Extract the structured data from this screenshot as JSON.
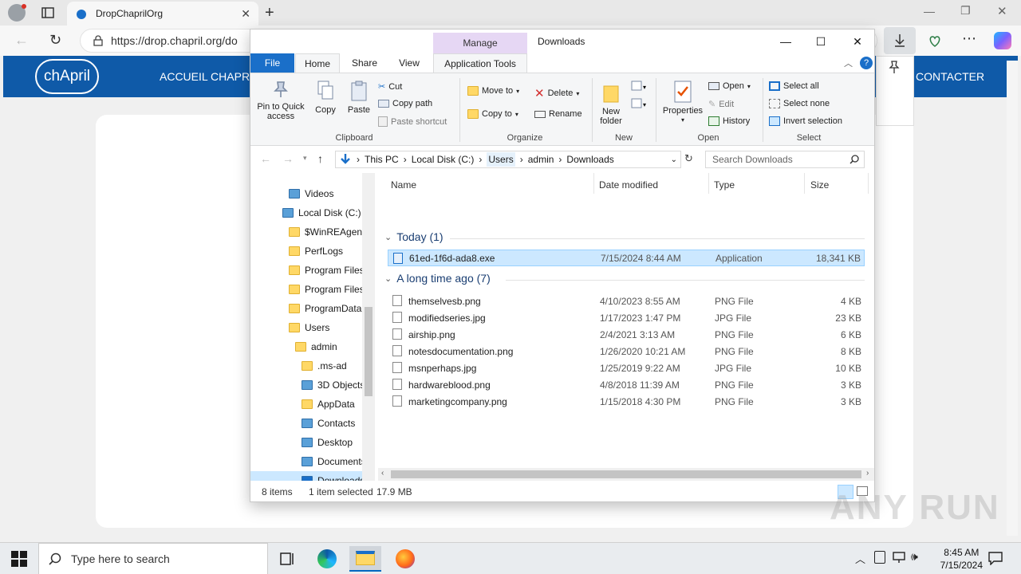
{
  "browser": {
    "tab_title": "DropChaprilOrg",
    "url": "https://drop.chapril.org/do"
  },
  "site": {
    "logo": "chApril",
    "nav": [
      "ACCUEIL CHAPRIL",
      "CONTACTER"
    ]
  },
  "explorer": {
    "contextual_tab": "Manage",
    "window_title": "Downloads",
    "ribbon_tabs": [
      "File",
      "Home",
      "Share",
      "View",
      "Application Tools"
    ],
    "clipboard": {
      "pin": "Pin to Quick access",
      "copy": "Copy",
      "paste": "Paste",
      "cut": "Cut",
      "copy_path": "Copy path",
      "paste_shortcut": "Paste shortcut",
      "label": "Clipboard"
    },
    "organize": {
      "move_to": "Move to",
      "copy_to": "Copy to",
      "delete": "Delete",
      "rename": "Rename",
      "label": "Organize"
    },
    "new": {
      "new_folder": "New folder",
      "label": "New"
    },
    "open": {
      "properties": "Properties",
      "open": "Open",
      "edit": "Edit",
      "history": "History",
      "label": "Open"
    },
    "select": {
      "select_all": "Select all",
      "select_none": "Select none",
      "invert": "Invert selection",
      "label": "Select"
    },
    "breadcrumb": [
      "This PC",
      "Local Disk (C:)",
      "Users",
      "admin",
      "Downloads"
    ],
    "search_placeholder": "Search Downloads",
    "tree": [
      {
        "label": "Videos",
        "indent": 1
      },
      {
        "label": "Local Disk (C:)",
        "indent": 0
      },
      {
        "label": "$WinREAgent",
        "indent": 1
      },
      {
        "label": "PerfLogs",
        "indent": 1
      },
      {
        "label": "Program Files",
        "indent": 1
      },
      {
        "label": "Program Files",
        "indent": 1
      },
      {
        "label": "ProgramData",
        "indent": 1
      },
      {
        "label": "Users",
        "indent": 1
      },
      {
        "label": "admin",
        "indent": 2
      },
      {
        "label": ".ms-ad",
        "indent": 3
      },
      {
        "label": "3D Objects",
        "indent": 3
      },
      {
        "label": "AppData",
        "indent": 3
      },
      {
        "label": "Contacts",
        "indent": 3
      },
      {
        "label": "Desktop",
        "indent": 3
      },
      {
        "label": "Documents",
        "indent": 3
      },
      {
        "label": "Downloads",
        "indent": 3
      }
    ],
    "columns": [
      "Name",
      "Date modified",
      "Type",
      "Size"
    ],
    "groups": [
      {
        "title": "Today (1)",
        "files": [
          {
            "name": "61ed-1f6d-ada8.exe",
            "date": "7/15/2024 8:44 AM",
            "type": "Application",
            "size": "18,341 KB",
            "selected": true
          }
        ]
      },
      {
        "title": "A long time ago (7)",
        "files": [
          {
            "name": "themselvesb.png",
            "date": "4/10/2023 8:55 AM",
            "type": "PNG File",
            "size": "4 KB"
          },
          {
            "name": "modifiedseries.jpg",
            "date": "1/17/2023 1:47 PM",
            "type": "JPG File",
            "size": "23 KB"
          },
          {
            "name": "airship.png",
            "date": "2/4/2021 3:13 AM",
            "type": "PNG File",
            "size": "6 KB"
          },
          {
            "name": "notesdocumentation.png",
            "date": "1/26/2020 10:21 AM",
            "type": "PNG File",
            "size": "8 KB"
          },
          {
            "name": "msnperhaps.jpg",
            "date": "1/25/2019 9:22 AM",
            "type": "JPG File",
            "size": "10 KB"
          },
          {
            "name": "hardwareblood.png",
            "date": "4/8/2018 11:39 AM",
            "type": "PNG File",
            "size": "3 KB"
          },
          {
            "name": "marketingcompany.png",
            "date": "1/15/2018 4:30 PM",
            "type": "PNG File",
            "size": "3 KB"
          }
        ]
      }
    ],
    "status": {
      "items": "8 items",
      "selected": "1 item selected",
      "size": "17.9 MB"
    }
  },
  "taskbar": {
    "search_placeholder": "Type here to search",
    "time": "8:45 AM",
    "date": "7/15/2024"
  },
  "watermark": "ANY RUN"
}
